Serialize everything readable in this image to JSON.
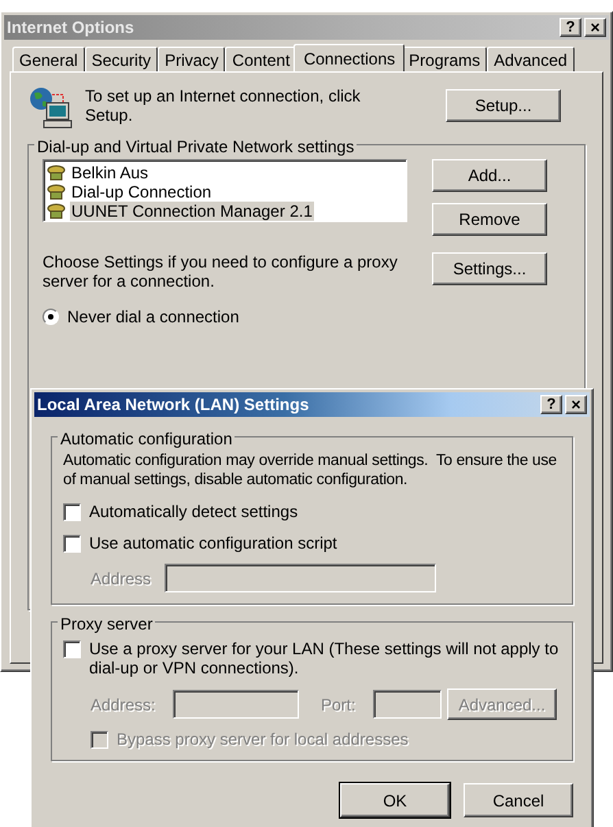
{
  "internet_options": {
    "title": "Internet Options",
    "help_button": "?",
    "close_button": "×",
    "tabs": [
      {
        "label": "General",
        "selected": false
      },
      {
        "label": "Security",
        "selected": false
      },
      {
        "label": "Privacy",
        "selected": false
      },
      {
        "label": "Content",
        "selected": false
      },
      {
        "label": "Connections",
        "selected": true
      },
      {
        "label": "Programs",
        "selected": false
      },
      {
        "label": "Advanced",
        "selected": false
      }
    ],
    "setup_text": "To set up an Internet connection, click Setup.",
    "setup_button": "Setup...",
    "dialup_group": {
      "label": "Dial-up and Virtual Private Network settings",
      "connections": [
        {
          "name": "Belkin Aus",
          "selected": false
        },
        {
          "name": "Dial-up Connection",
          "selected": false
        },
        {
          "name": "UUNET Connection Manager 2.1",
          "selected": true
        }
      ],
      "buttons": [
        "Add...",
        "Remove"
      ]
    },
    "proxy_text": "Choose Settings if you need to configure a proxy server for a connection.",
    "settings_button": "Settings...",
    "dial_option": {
      "label": "Never dial a connection",
      "selected": true
    }
  },
  "lan_dialog": {
    "title": "Local Area Network (LAN) Settings",
    "help_button": "?",
    "close_button": "×",
    "auto_config": {
      "label": "Automatic configuration",
      "description": "Automatic configuration may override manual settings.  To ensure the use of manual settings, disable automatic configuration.",
      "options": [
        {
          "label": "Automatically detect settings",
          "checked": false,
          "disabled": false
        },
        {
          "label": "Use automatic configuration script",
          "checked": false,
          "disabled": false
        }
      ],
      "address": {
        "label": "Address",
        "disabled": true
      }
    },
    "proxy": {
      "label": "Proxy server",
      "use_proxy": {
        "label": "Use a proxy server for your LAN (These settings will not apply to dial-up or VPN connections).",
        "checked": false,
        "disabled": false
      },
      "address": {
        "label": "Address:",
        "disabled": true
      },
      "port": {
        "label": "Port:",
        "disabled": true
      },
      "advanced_button": {
        "label": "Advanced...",
        "disabled": true
      },
      "bypass": {
        "label": "Bypass proxy server for local addresses",
        "checked": false,
        "disabled": true
      }
    },
    "buttons": [
      {
        "label": "OK",
        "default": true
      },
      {
        "label": "Cancel",
        "default": false
      }
    ]
  }
}
